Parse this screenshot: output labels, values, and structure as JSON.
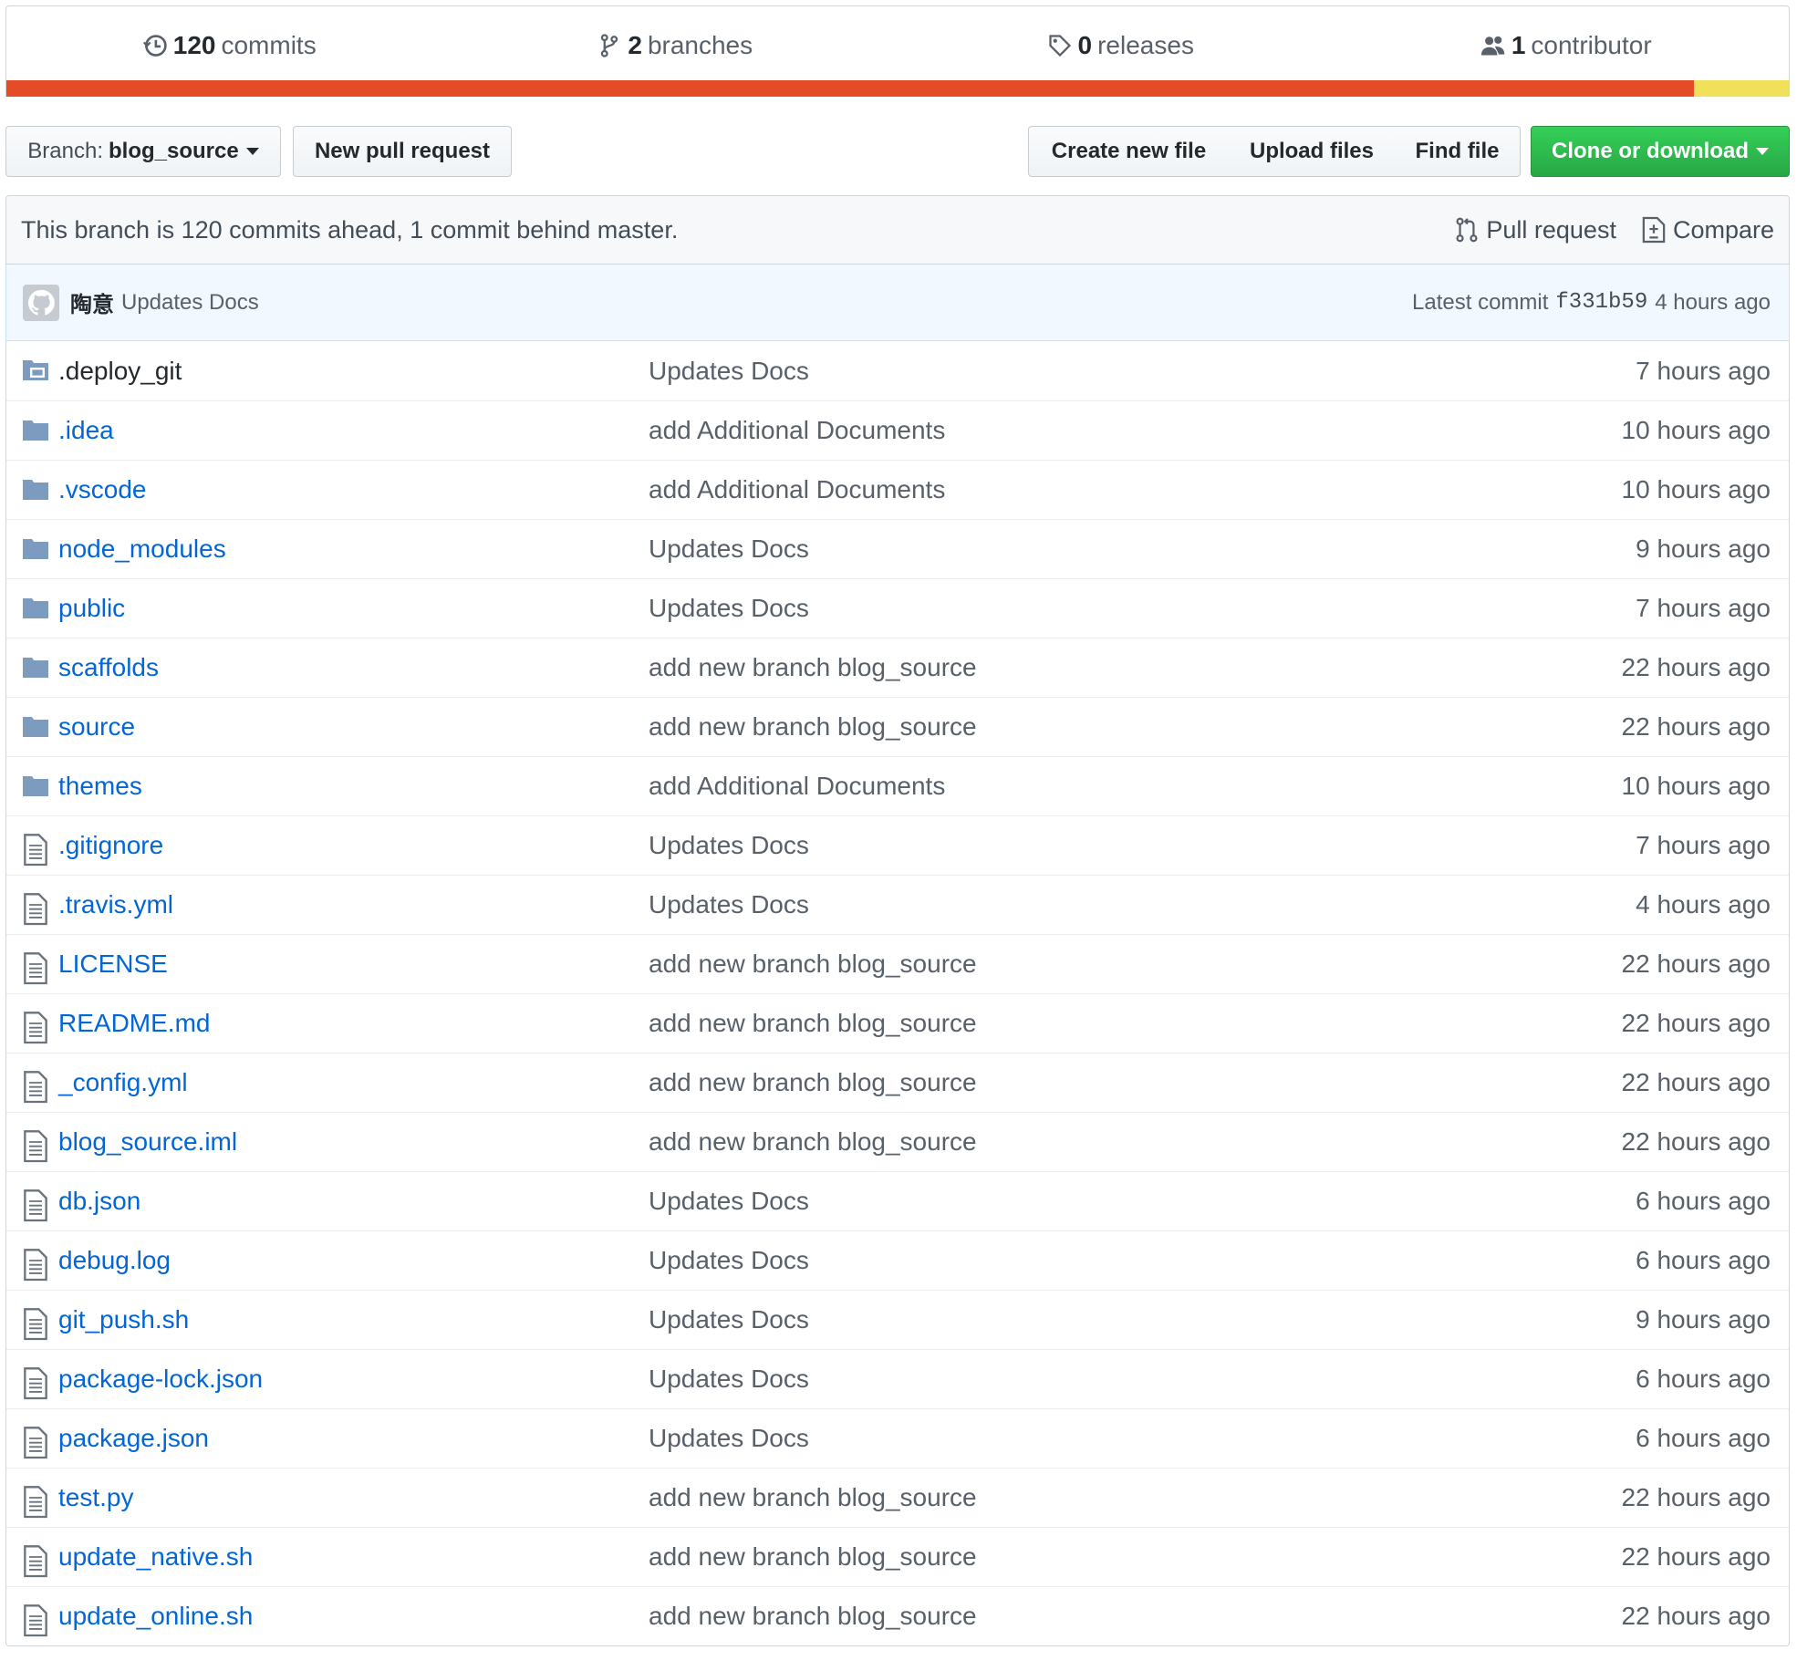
{
  "summary": {
    "commits": {
      "count": "120",
      "label": "commits"
    },
    "branches": {
      "count": "2",
      "label": "branches"
    },
    "releases": {
      "count": "0",
      "label": "releases"
    },
    "contributors": {
      "count": "1",
      "label": "contributor"
    }
  },
  "language_bar": [
    {
      "color": "#e34c26",
      "percent": 94.7
    },
    {
      "color": "#f1e05a",
      "percent": 5.3
    }
  ],
  "toolbar": {
    "branch_prefix": "Branch:",
    "branch_name": "blog_source",
    "new_pull_request": "New pull request",
    "create_new_file": "Create new file",
    "upload_files": "Upload files",
    "find_file": "Find file",
    "clone_or_download": "Clone or download"
  },
  "branch_info": {
    "text": "This branch is 120 commits ahead, 1 commit behind master.",
    "pull_request": "Pull request",
    "compare": "Compare"
  },
  "latest_commit": {
    "author": "陶意",
    "message": "Updates Docs",
    "label": "Latest commit",
    "sha": "f331b59",
    "age": "4 hours ago"
  },
  "files": [
    {
      "name": ".deploy_git",
      "type": "submodule",
      "message": "Updates Docs",
      "age": "7 hours ago"
    },
    {
      "name": ".idea",
      "type": "dir",
      "message": "add Additional Documents",
      "age": "10 hours ago"
    },
    {
      "name": ".vscode",
      "type": "dir",
      "message": "add Additional Documents",
      "age": "10 hours ago"
    },
    {
      "name": "node_modules",
      "type": "dir",
      "message": "Updates Docs",
      "age": "9 hours ago"
    },
    {
      "name": "public",
      "type": "dir",
      "message": "Updates Docs",
      "age": "7 hours ago"
    },
    {
      "name": "scaffolds",
      "type": "dir",
      "message": "add new branch blog_source",
      "age": "22 hours ago"
    },
    {
      "name": "source",
      "type": "dir",
      "message": "add new branch blog_source",
      "age": "22 hours ago"
    },
    {
      "name": "themes",
      "type": "dir",
      "message": "add Additional Documents",
      "age": "10 hours ago"
    },
    {
      "name": ".gitignore",
      "type": "file",
      "message": "Updates Docs",
      "age": "7 hours ago"
    },
    {
      "name": ".travis.yml",
      "type": "file",
      "message": "Updates Docs",
      "age": "4 hours ago"
    },
    {
      "name": "LICENSE",
      "type": "file",
      "message": "add new branch blog_source",
      "age": "22 hours ago"
    },
    {
      "name": "README.md",
      "type": "file",
      "message": "add new branch blog_source",
      "age": "22 hours ago"
    },
    {
      "name": "_config.yml",
      "type": "file",
      "message": "add new branch blog_source",
      "age": "22 hours ago"
    },
    {
      "name": "blog_source.iml",
      "type": "file",
      "message": "add new branch blog_source",
      "age": "22 hours ago"
    },
    {
      "name": "db.json",
      "type": "file",
      "message": "Updates Docs",
      "age": "6 hours ago"
    },
    {
      "name": "debug.log",
      "type": "file",
      "message": "Updates Docs",
      "age": "6 hours ago"
    },
    {
      "name": "git_push.sh",
      "type": "file",
      "message": "Updates Docs",
      "age": "9 hours ago"
    },
    {
      "name": "package-lock.json",
      "type": "file",
      "message": "Updates Docs",
      "age": "6 hours ago"
    },
    {
      "name": "package.json",
      "type": "file",
      "message": "Updates Docs",
      "age": "6 hours ago"
    },
    {
      "name": "test.py",
      "type": "file",
      "message": "add new branch blog_source",
      "age": "22 hours ago"
    },
    {
      "name": "update_native.sh",
      "type": "file",
      "message": "add new branch blog_source",
      "age": "22 hours ago"
    },
    {
      "name": "update_online.sh",
      "type": "file",
      "message": "add new branch blog_source",
      "age": "22 hours ago"
    }
  ]
}
